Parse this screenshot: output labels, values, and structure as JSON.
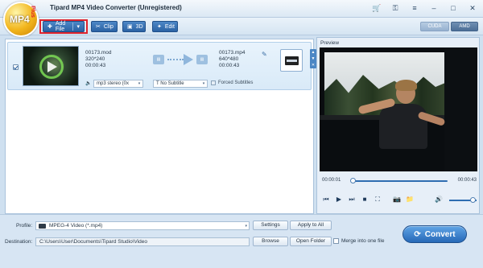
{
  "window": {
    "title": "Tipard MP4 Video Converter (Unregistered)",
    "logo_text": "MP4",
    "logo_plus": "Plus"
  },
  "toolbar": {
    "add_file_label": "Add File",
    "clip_label": "Clip",
    "threed_label": "3D",
    "edit_label": "Edit",
    "cuda_label": "CUDA",
    "amd_label": "AMD"
  },
  "file_item": {
    "source_name": "00173.mod",
    "source_resolution": "320*240",
    "source_duration": "00:00:43",
    "output_name": "00173.mp4",
    "output_resolution": "640*480",
    "output_duration": "00:00:43",
    "audio_track": "mp3 stereo (0x",
    "subtitle": "No Subtitle",
    "forced_subtitles_label": "Forced Subtitles"
  },
  "preview": {
    "label": "Preview",
    "current_time": "00:00:01",
    "total_time": "00:00:43",
    "progress": 0.02,
    "volume": 0.85
  },
  "bottom": {
    "profile_label": "Profile:",
    "profile_value": "MPEG-4 Video (*.mp4)",
    "settings_label": "Settings",
    "apply_all_label": "Apply to All",
    "destination_label": "Destination:",
    "destination_value": "C:\\Users\\User\\Documents\\Tipard Studio\\Video",
    "browse_label": "Browse",
    "open_folder_label": "Open Folder",
    "merge_label": "Merge into one file",
    "convert_label": "Convert"
  },
  "colors": {
    "accent": "#2b62a4",
    "highlight_border": "#e0232c",
    "background": "#cfe0f0"
  },
  "icons": [
    "logo-icon",
    "cart-icon",
    "key-icon",
    "minimize-icon",
    "maximize-icon",
    "close-icon",
    "plus-icon",
    "scissors-icon",
    "threed-icon",
    "sparkle-icon",
    "pencil-icon",
    "film-icon",
    "speaker-icon",
    "play-icon",
    "prev-icon",
    "next-icon",
    "stop-icon",
    "snapshot-icon",
    "folder-icon",
    "volume-icon",
    "convert-icon"
  ]
}
